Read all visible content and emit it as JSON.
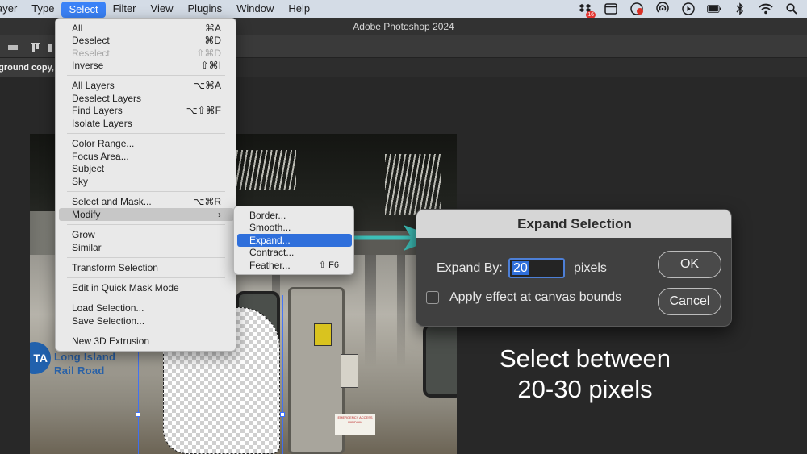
{
  "menubar": {
    "menus": [
      "ayer",
      "Type",
      "Select",
      "Filter",
      "View",
      "Plugins",
      "Window",
      "Help"
    ],
    "active_index": 2,
    "badge_count": "16",
    "status_icons": [
      "dropbox-icon",
      "window-icon",
      "screen-record-icon",
      "airdrop-icon",
      "play-icon",
      "battery-icon",
      "bluetooth-icon",
      "wifi-icon",
      "search-icon"
    ]
  },
  "app": {
    "title": "Adobe Photoshop 2024",
    "doc_tab": "kground copy,"
  },
  "select_menu": {
    "items": [
      {
        "label": "All",
        "shortcut": "⌘A"
      },
      {
        "label": "Deselect",
        "shortcut": "⌘D"
      },
      {
        "label": "Reselect",
        "shortcut": "⇧⌘D",
        "disabled": true
      },
      {
        "label": "Inverse",
        "shortcut": "⇧⌘I"
      },
      {
        "label": "All Layers",
        "shortcut": "⌥⌘A"
      },
      {
        "label": "Deselect Layers",
        "shortcut": ""
      },
      {
        "label": "Find Layers",
        "shortcut": "⌥⇧⌘F"
      },
      {
        "label": "Isolate Layers",
        "shortcut": ""
      },
      {
        "label": "Color Range...",
        "shortcut": ""
      },
      {
        "label": "Focus Area...",
        "shortcut": ""
      },
      {
        "label": "Subject",
        "shortcut": ""
      },
      {
        "label": "Sky",
        "shortcut": ""
      },
      {
        "label": "Select and Mask...",
        "shortcut": "⌥⌘R"
      },
      {
        "label": "Modify",
        "shortcut": "›",
        "highlighted": true
      },
      {
        "label": "Grow",
        "shortcut": ""
      },
      {
        "label": "Similar",
        "shortcut": ""
      },
      {
        "label": "Transform Selection",
        "shortcut": ""
      },
      {
        "label": "Edit in Quick Mask Mode",
        "shortcut": ""
      },
      {
        "label": "Load Selection...",
        "shortcut": ""
      },
      {
        "label": "Save Selection...",
        "shortcut": ""
      },
      {
        "label": "New 3D Extrusion",
        "shortcut": ""
      }
    ]
  },
  "modify_submenu": {
    "items": [
      {
        "label": "Border...",
        "shortcut": ""
      },
      {
        "label": "Smooth...",
        "shortcut": ""
      },
      {
        "label": "Expand...",
        "shortcut": "",
        "selected": true
      },
      {
        "label": "Contract...",
        "shortcut": ""
      },
      {
        "label": "Feather...",
        "shortcut": "⇧ F6"
      }
    ]
  },
  "dialog": {
    "title": "Expand Selection",
    "expand_label": "Expand By:",
    "expand_value": "20",
    "unit": "pixels",
    "checkbox_label": "Apply effect at canvas bounds",
    "checkbox_checked": false,
    "ok_label": "OK",
    "cancel_label": "Cancel"
  },
  "canvas": {
    "logo_text": "MTA",
    "logo_visible": "TA",
    "lirr_line1": "Long Island",
    "lirr_line2": "Rail Road",
    "emergency_text": "EMERGENCY ACCESS WINDOW"
  },
  "annotation": {
    "line1": "Select between",
    "line2": "20-30 pixels",
    "arrow_color": "#3dbfb8"
  },
  "colors": {
    "menu_highlight": "#3a82f7",
    "selected_item": "#2f6fdb",
    "dialog_bg": "#404040",
    "dialog_header": "#d6d6d6"
  }
}
